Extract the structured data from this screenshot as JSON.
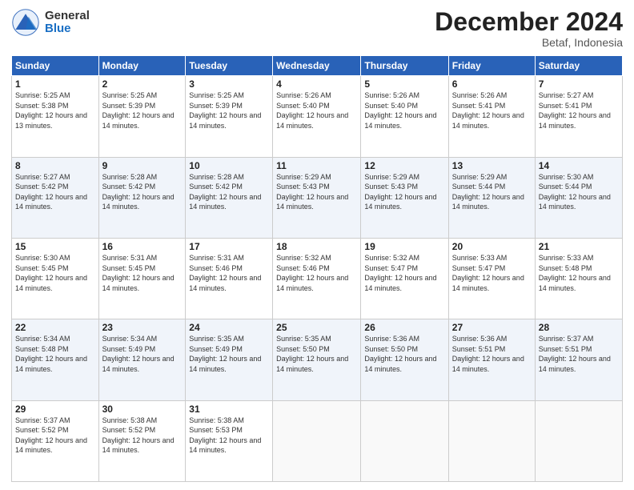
{
  "logo": {
    "general": "General",
    "blue": "Blue"
  },
  "header": {
    "month": "December 2024",
    "location": "Betaf, Indonesia"
  },
  "weekdays": [
    "Sunday",
    "Monday",
    "Tuesday",
    "Wednesday",
    "Thursday",
    "Friday",
    "Saturday"
  ],
  "weeks": [
    [
      {
        "day": "1",
        "sunrise": "Sunrise: 5:25 AM",
        "sunset": "Sunset: 5:38 PM",
        "daylight": "Daylight: 12 hours and 13 minutes."
      },
      {
        "day": "2",
        "sunrise": "Sunrise: 5:25 AM",
        "sunset": "Sunset: 5:39 PM",
        "daylight": "Daylight: 12 hours and 14 minutes."
      },
      {
        "day": "3",
        "sunrise": "Sunrise: 5:25 AM",
        "sunset": "Sunset: 5:39 PM",
        "daylight": "Daylight: 12 hours and 14 minutes."
      },
      {
        "day": "4",
        "sunrise": "Sunrise: 5:26 AM",
        "sunset": "Sunset: 5:40 PM",
        "daylight": "Daylight: 12 hours and 14 minutes."
      },
      {
        "day": "5",
        "sunrise": "Sunrise: 5:26 AM",
        "sunset": "Sunset: 5:40 PM",
        "daylight": "Daylight: 12 hours and 14 minutes."
      },
      {
        "day": "6",
        "sunrise": "Sunrise: 5:26 AM",
        "sunset": "Sunset: 5:41 PM",
        "daylight": "Daylight: 12 hours and 14 minutes."
      },
      {
        "day": "7",
        "sunrise": "Sunrise: 5:27 AM",
        "sunset": "Sunset: 5:41 PM",
        "daylight": "Daylight: 12 hours and 14 minutes."
      }
    ],
    [
      {
        "day": "8",
        "sunrise": "Sunrise: 5:27 AM",
        "sunset": "Sunset: 5:42 PM",
        "daylight": "Daylight: 12 hours and 14 minutes."
      },
      {
        "day": "9",
        "sunrise": "Sunrise: 5:28 AM",
        "sunset": "Sunset: 5:42 PM",
        "daylight": "Daylight: 12 hours and 14 minutes."
      },
      {
        "day": "10",
        "sunrise": "Sunrise: 5:28 AM",
        "sunset": "Sunset: 5:42 PM",
        "daylight": "Daylight: 12 hours and 14 minutes."
      },
      {
        "day": "11",
        "sunrise": "Sunrise: 5:29 AM",
        "sunset": "Sunset: 5:43 PM",
        "daylight": "Daylight: 12 hours and 14 minutes."
      },
      {
        "day": "12",
        "sunrise": "Sunrise: 5:29 AM",
        "sunset": "Sunset: 5:43 PM",
        "daylight": "Daylight: 12 hours and 14 minutes."
      },
      {
        "day": "13",
        "sunrise": "Sunrise: 5:29 AM",
        "sunset": "Sunset: 5:44 PM",
        "daylight": "Daylight: 12 hours and 14 minutes."
      },
      {
        "day": "14",
        "sunrise": "Sunrise: 5:30 AM",
        "sunset": "Sunset: 5:44 PM",
        "daylight": "Daylight: 12 hours and 14 minutes."
      }
    ],
    [
      {
        "day": "15",
        "sunrise": "Sunrise: 5:30 AM",
        "sunset": "Sunset: 5:45 PM",
        "daylight": "Daylight: 12 hours and 14 minutes."
      },
      {
        "day": "16",
        "sunrise": "Sunrise: 5:31 AM",
        "sunset": "Sunset: 5:45 PM",
        "daylight": "Daylight: 12 hours and 14 minutes."
      },
      {
        "day": "17",
        "sunrise": "Sunrise: 5:31 AM",
        "sunset": "Sunset: 5:46 PM",
        "daylight": "Daylight: 12 hours and 14 minutes."
      },
      {
        "day": "18",
        "sunrise": "Sunrise: 5:32 AM",
        "sunset": "Sunset: 5:46 PM",
        "daylight": "Daylight: 12 hours and 14 minutes."
      },
      {
        "day": "19",
        "sunrise": "Sunrise: 5:32 AM",
        "sunset": "Sunset: 5:47 PM",
        "daylight": "Daylight: 12 hours and 14 minutes."
      },
      {
        "day": "20",
        "sunrise": "Sunrise: 5:33 AM",
        "sunset": "Sunset: 5:47 PM",
        "daylight": "Daylight: 12 hours and 14 minutes."
      },
      {
        "day": "21",
        "sunrise": "Sunrise: 5:33 AM",
        "sunset": "Sunset: 5:48 PM",
        "daylight": "Daylight: 12 hours and 14 minutes."
      }
    ],
    [
      {
        "day": "22",
        "sunrise": "Sunrise: 5:34 AM",
        "sunset": "Sunset: 5:48 PM",
        "daylight": "Daylight: 12 hours and 14 minutes."
      },
      {
        "day": "23",
        "sunrise": "Sunrise: 5:34 AM",
        "sunset": "Sunset: 5:49 PM",
        "daylight": "Daylight: 12 hours and 14 minutes."
      },
      {
        "day": "24",
        "sunrise": "Sunrise: 5:35 AM",
        "sunset": "Sunset: 5:49 PM",
        "daylight": "Daylight: 12 hours and 14 minutes."
      },
      {
        "day": "25",
        "sunrise": "Sunrise: 5:35 AM",
        "sunset": "Sunset: 5:50 PM",
        "daylight": "Daylight: 12 hours and 14 minutes."
      },
      {
        "day": "26",
        "sunrise": "Sunrise: 5:36 AM",
        "sunset": "Sunset: 5:50 PM",
        "daylight": "Daylight: 12 hours and 14 minutes."
      },
      {
        "day": "27",
        "sunrise": "Sunrise: 5:36 AM",
        "sunset": "Sunset: 5:51 PM",
        "daylight": "Daylight: 12 hours and 14 minutes."
      },
      {
        "day": "28",
        "sunrise": "Sunrise: 5:37 AM",
        "sunset": "Sunset: 5:51 PM",
        "daylight": "Daylight: 12 hours and 14 minutes."
      }
    ],
    [
      {
        "day": "29",
        "sunrise": "Sunrise: 5:37 AM",
        "sunset": "Sunset: 5:52 PM",
        "daylight": "Daylight: 12 hours and 14 minutes."
      },
      {
        "day": "30",
        "sunrise": "Sunrise: 5:38 AM",
        "sunset": "Sunset: 5:52 PM",
        "daylight": "Daylight: 12 hours and 14 minutes."
      },
      {
        "day": "31",
        "sunrise": "Sunrise: 5:38 AM",
        "sunset": "Sunset: 5:53 PM",
        "daylight": "Daylight: 12 hours and 14 minutes."
      },
      null,
      null,
      null,
      null
    ]
  ]
}
